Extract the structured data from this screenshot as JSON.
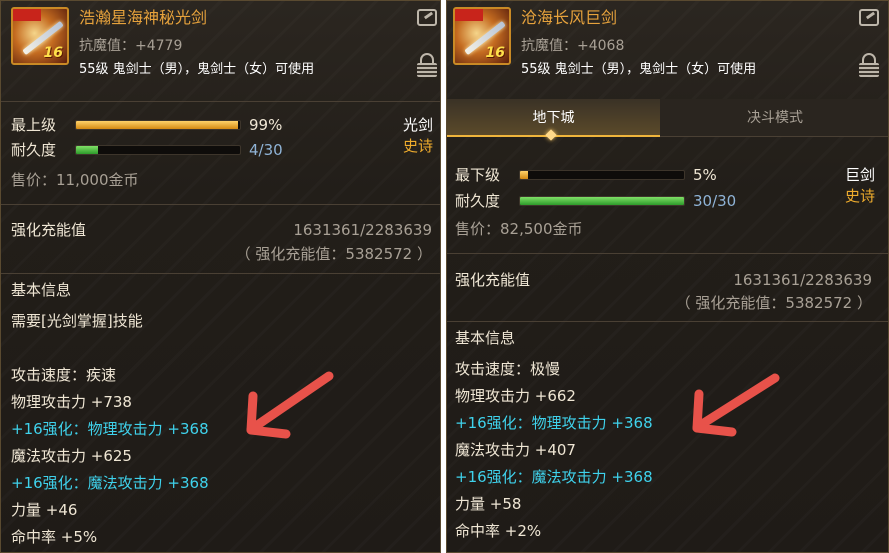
{
  "left": {
    "icon": "sword-icon",
    "icon_badge": "",
    "icon_level": "16",
    "name": "浩瀚星海神秘光剑",
    "anti_magic": "抗魔值：+4779",
    "requirement": "55级 鬼剑士（男），鬼剑士（女）可使用",
    "grade_label": "最上级",
    "grade_value": "99%",
    "grade_fill": 0.99,
    "durability_label": "耐久度",
    "durability_value": "4/30",
    "durability_fill": 0.1333,
    "weapon_type": "光剑",
    "rarity": "史诗",
    "price": "售价：11,000金币",
    "charge_label": "强化充能值",
    "charge_value": "1631361/2283639",
    "charge_total": "（ 强化充能值：5382572 ）",
    "basic_info": "基本信息",
    "skill_req": "需要[光剑掌握]技能",
    "stats": [
      {
        "text": "攻击速度：疾速",
        "color": "white"
      },
      {
        "text": "物理攻击力 +738",
        "color": "white"
      },
      {
        "text": "+16强化：物理攻击力 +368",
        "color": "cyan"
      },
      {
        "text": "魔法攻击力 +625",
        "color": "white"
      },
      {
        "text": "+16强化：魔法攻击力 +368",
        "color": "cyan"
      },
      {
        "text": "力量 +46",
        "color": "white"
      },
      {
        "text": "命中率 +5%",
        "color": "white"
      }
    ]
  },
  "right": {
    "icon": "sword-icon",
    "icon_badge": "",
    "icon_level": "16",
    "name": "沧海长风巨剑",
    "anti_magic": "抗魔值：+4068",
    "requirement": "55级 鬼剑士（男），鬼剑士（女）可使用",
    "tabs": [
      "地下城",
      "决斗模式"
    ],
    "grade_label": "最下级",
    "grade_value": "5%",
    "grade_fill": 0.05,
    "durability_label": "耐久度",
    "durability_value": "30/30",
    "durability_fill": 1.0,
    "weapon_type": "巨剑",
    "rarity": "史诗",
    "price": "售价：82,500金币",
    "charge_label": "强化充能值",
    "charge_value": "1631361/2283639",
    "charge_total": "（ 强化充能值：5382572 ）",
    "basic_info": "基本信息",
    "stats": [
      {
        "text": "攻击速度：极慢",
        "color": "white"
      },
      {
        "text": "物理攻击力 +662",
        "color": "white"
      },
      {
        "text": "+16强化：物理攻击力 +368",
        "color": "cyan"
      },
      {
        "text": "魔法攻击力 +407",
        "color": "white"
      },
      {
        "text": "+16强化：魔法攻击力 +368",
        "color": "cyan"
      },
      {
        "text": "力量 +58",
        "color": "white"
      },
      {
        "text": "命中率 +2%",
        "color": "white"
      }
    ]
  },
  "colors": {
    "name": "#e6a23c",
    "rarity": "#f0ad2d",
    "enhance": "#3fd2ec",
    "annotation_arrow": "#e8524a"
  },
  "annotations": [
    "arrow-pointing-to-enhancement-left",
    "arrow-pointing-to-enhancement-right"
  ]
}
